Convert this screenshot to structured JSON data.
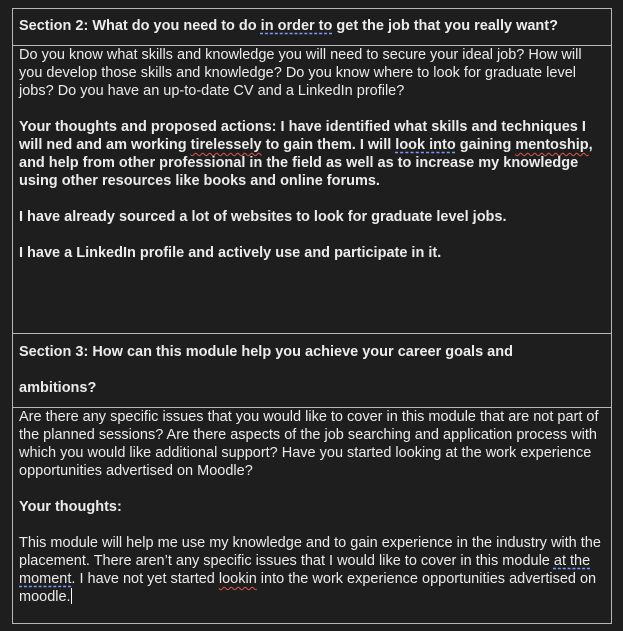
{
  "section2": {
    "heading_a": "Section 2: What do you need to do ",
    "heading_flag": "in order to",
    "heading_b": " get the job that you really want?",
    "prompt": "Do you know what skills and knowledge you will need to secure your ideal job? How will you develop those skills and knowledge? Do you know where to look for graduate level jobs? Do you have an up-to-date CV and a LinkedIn profile?",
    "answer1_a": "Your thoughts and proposed actions: I have identified what skills and techniques I will ned and am working ",
    "answer1_flag1": "tirelessely",
    "answer1_b": " to gain them. I will ",
    "answer1_flag2": "look into",
    "answer1_c": " gaining ",
    "answer1_flag3": "mentoship",
    "answer1_d": ", and help from other professional in the field as well as to increase my knowledge using other resources like books and online forums.",
    "answer2": "I have already sourced a lot of websites to look for graduate level jobs.",
    "answer3": "I have a LinkedIn profile and actively use and participate in it."
  },
  "section3": {
    "heading_line1": "Section 3: How can this module help you achieve your career goals and",
    "heading_line2": "ambitions?",
    "prompt": "Are there any specific issues that you would like to cover in this module that are not part of the planned sessions? Are there aspects of the job searching and application process with which you would like additional support? Have you started looking at the work experience opportunities advertised on Moodle?",
    "thoughts_label": "Your thoughts:",
    "answer_a": "This module will help me use my knowledge and to gain experience in the industry with the placement. There aren’t any specific issues that I would like to cover in this module ",
    "answer_flag1": "at the moment",
    "answer_b": ". I have not yet started ",
    "answer_flag2": "lookin",
    "answer_c": " into the work experience opportunities advertised on moodle."
  }
}
